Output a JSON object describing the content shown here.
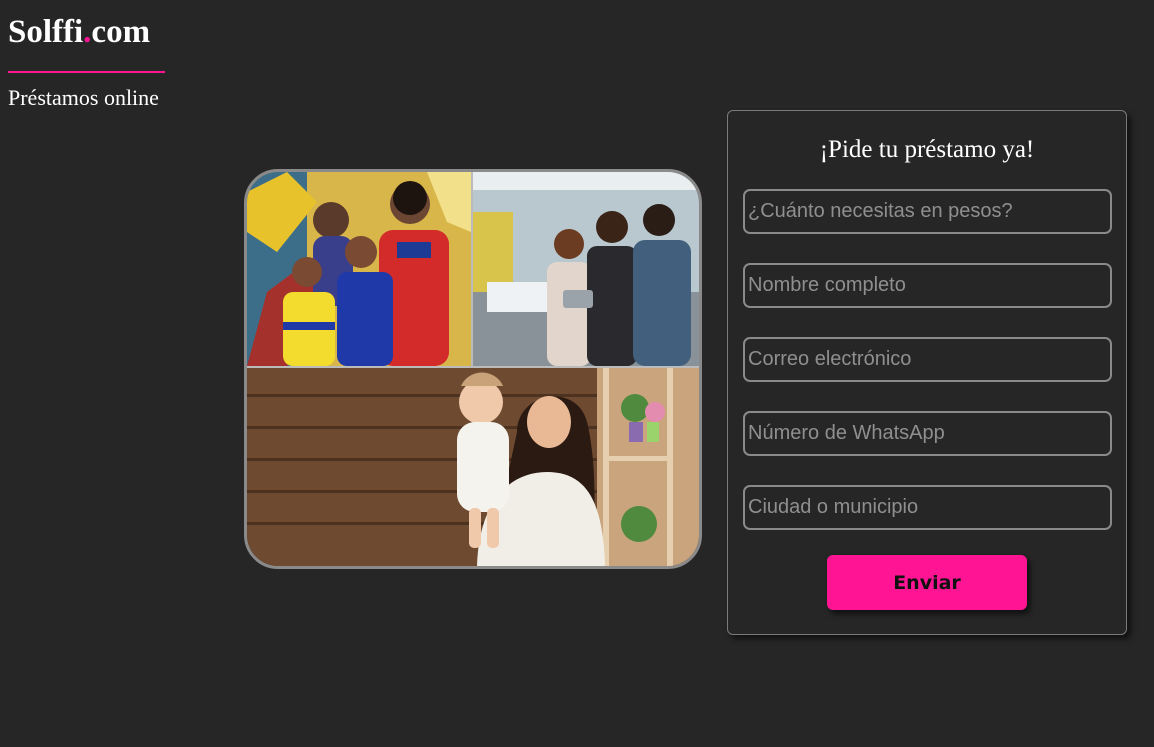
{
  "brand": {
    "name_main": "Solffi",
    "name_dot": ".",
    "name_tld": "com",
    "tagline": "Préstamos online",
    "accent_color": "#ff1493"
  },
  "form": {
    "title": "¡Pide tu préstamo ya!",
    "fields": [
      {
        "placeholder": "¿Cuánto necesitas en pesos?"
      },
      {
        "placeholder": "Nombre completo"
      },
      {
        "placeholder": "Correo electrónico"
      },
      {
        "placeholder": "Número de WhatsApp"
      },
      {
        "placeholder": "Ciudad o municipio"
      }
    ],
    "submit_label": "Enviar"
  },
  "collage": {
    "photos": [
      "family-photo",
      "office-team-photo",
      "mother-baby-photo"
    ]
  }
}
